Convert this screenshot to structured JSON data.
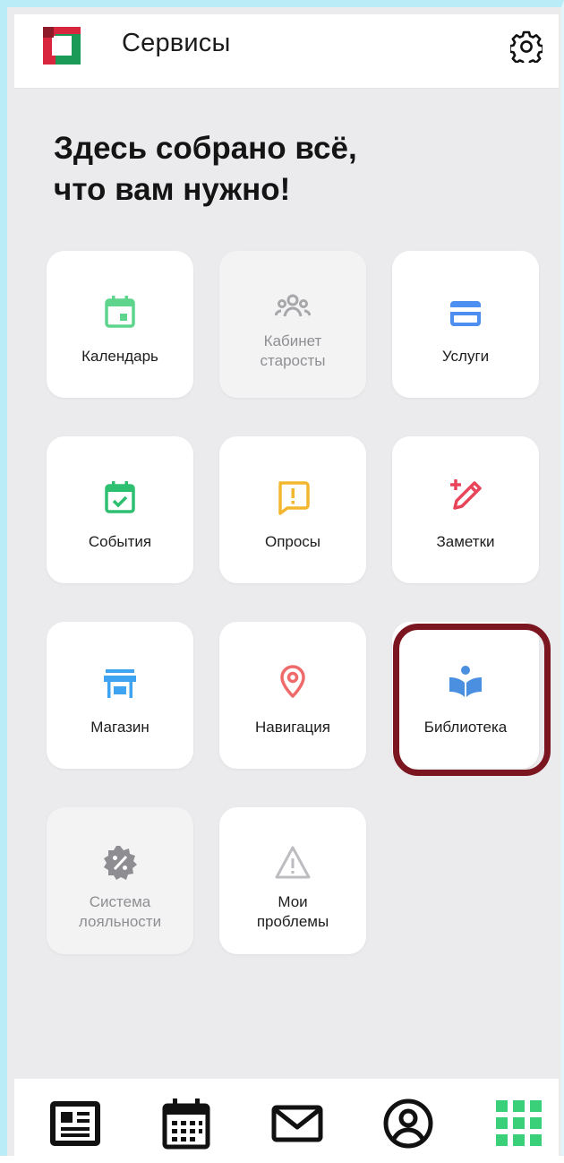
{
  "header": {
    "title": "Сервисы"
  },
  "headline": "Здесь собрано всё,\nчто вам нужно!",
  "tiles": [
    {
      "label": "Календарь",
      "icon": "calendar-icon",
      "color": "#5fd48c",
      "enabled": true
    },
    {
      "label": "Кабинет\nстаросты",
      "icon": "group-icon",
      "color": "#a7a7ab",
      "enabled": false
    },
    {
      "label": "Услуги",
      "icon": "card-icon",
      "color": "#4c8ff0",
      "enabled": true
    },
    {
      "label": "События",
      "icon": "calendar-check-icon",
      "color": "#2fbf71",
      "enabled": true
    },
    {
      "label": "Опросы",
      "icon": "comment-alert-icon",
      "color": "#f3b72f",
      "enabled": true
    },
    {
      "label": "Заметки",
      "icon": "pencil-plus-icon",
      "color": "#e8455b",
      "enabled": true
    },
    {
      "label": "Магазин",
      "icon": "store-icon",
      "color": "#3ea3f0",
      "enabled": true
    },
    {
      "label": "Навигация",
      "icon": "map-pin-icon",
      "color": "#ef6b6b",
      "enabled": true
    },
    {
      "label": "Библиотека",
      "icon": "book-reader-icon",
      "color": "#4a8fe0",
      "enabled": true
    },
    {
      "label": "Система\nлояльности",
      "icon": "discount-badge-icon",
      "color": "#8d8d92",
      "enabled": false
    },
    {
      "label": "Мои\nпроблемы",
      "icon": "warning-icon",
      "color": "#bdbdc1",
      "enabled": true
    }
  ],
  "bottom_nav": [
    {
      "icon": "news-icon",
      "color": "#111111"
    },
    {
      "icon": "calendar-icon",
      "color": "#111111"
    },
    {
      "icon": "mail-icon",
      "color": "#111111"
    },
    {
      "icon": "profile-icon",
      "color": "#111111"
    },
    {
      "icon": "grid-icon",
      "color": "#3ad07a",
      "active": true
    }
  ],
  "colors": {
    "background": "#ebebed",
    "tile": "#ffffff",
    "highlight": "#7b1520",
    "accent": "#3ad07a"
  }
}
